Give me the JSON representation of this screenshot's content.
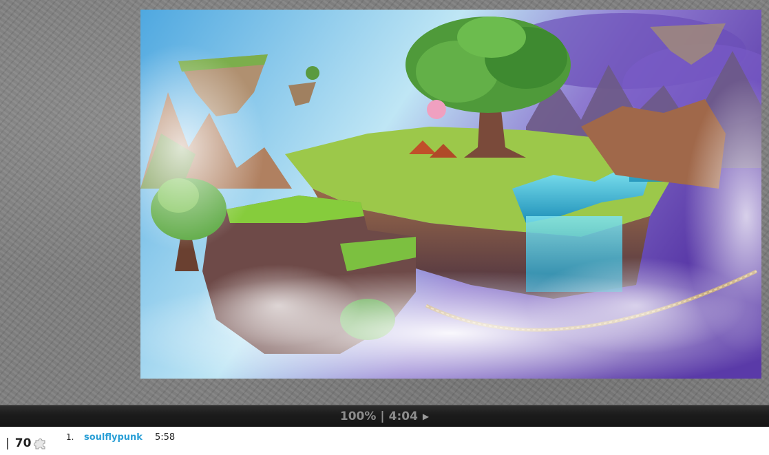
{
  "puzzle": {
    "image_alt": "Fantasy floating islands landscape puzzle image"
  },
  "status": {
    "progress": "100%",
    "separator": "|",
    "elapsed": "4:04",
    "play_icon": "play-icon"
  },
  "footer": {
    "separator": "|",
    "piece_count": "70",
    "piece_icon": "puzzle-piece-icon"
  },
  "leaderboard": {
    "entries": [
      {
        "rank": "1.",
        "user": "soulflypunk",
        "time": "5:58"
      }
    ]
  },
  "colors": {
    "link": "#2a9fd6",
    "status_bar": "#1c1c1c",
    "status_text": "#8c8c8c"
  }
}
